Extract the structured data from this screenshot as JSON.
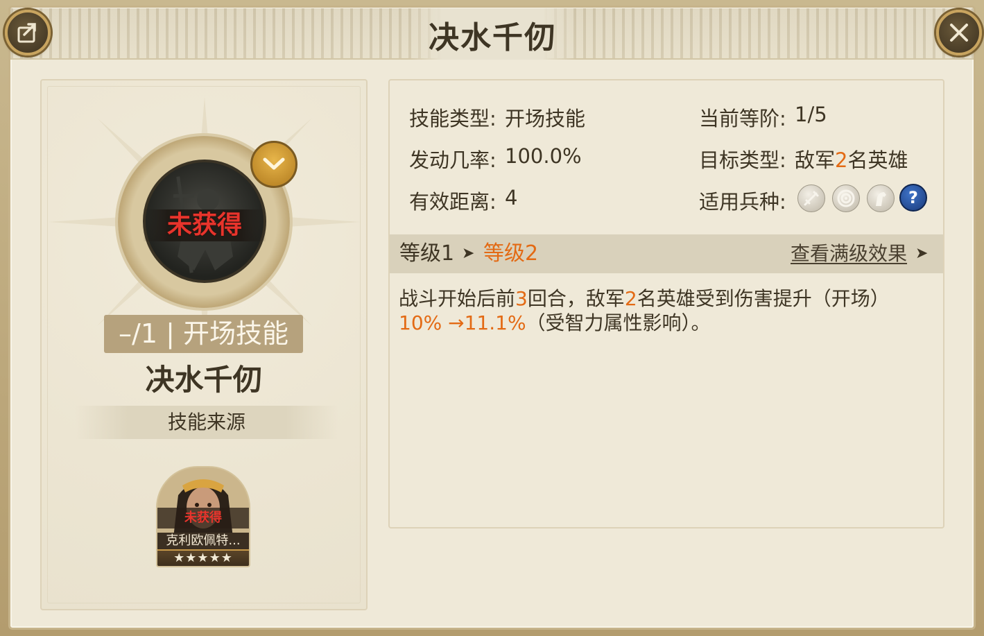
{
  "window": {
    "title": "决水千仞"
  },
  "left_panel": {
    "unobtained": "未获得",
    "level_tag": "–/1 | 开场技能",
    "skill_name": "决水千仞",
    "source_label": "技能来源",
    "hero": {
      "unobtained": "未获得",
      "name": "克利欧佩特...",
      "stars": "★★★★★",
      "star_count": 5
    }
  },
  "info": {
    "skill_type_label": "技能类型:",
    "skill_type_value": "开场技能",
    "current_rank_label": "当前等阶:",
    "current_rank_value": "1/5",
    "trigger_rate_label": "发动几率:",
    "trigger_rate_value": "100.0%",
    "target_type_label": "目标类型:",
    "target_type_prefix": "敌军",
    "target_type_count": "2",
    "target_type_suffix": "名英雄",
    "range_label": "有效距离:",
    "range_value": "4",
    "troop_label": "适用兵种:",
    "troop_icons": [
      "sword-icon",
      "target-icon",
      "horse-icon",
      "question-icon"
    ],
    "help_glyph": "?"
  },
  "level_bar": {
    "from": "等级1",
    "arrow": "➤",
    "to": "等级2",
    "full_effect": "查看满级效果",
    "full_arrow": "➤"
  },
  "description": {
    "p1": "战斗开始后前",
    "n1": "3",
    "p2": "回合，敌军",
    "n2": "2",
    "p3": "名英雄受到伤害提升（开场）",
    "v1": "10% →11.1%",
    "p4": "（受智力属性影响）。"
  },
  "colors": {
    "highlight": "#e36a14",
    "unobtained": "#e8342c",
    "text": "#3e3524",
    "panel_bg": "#efe9d8"
  }
}
